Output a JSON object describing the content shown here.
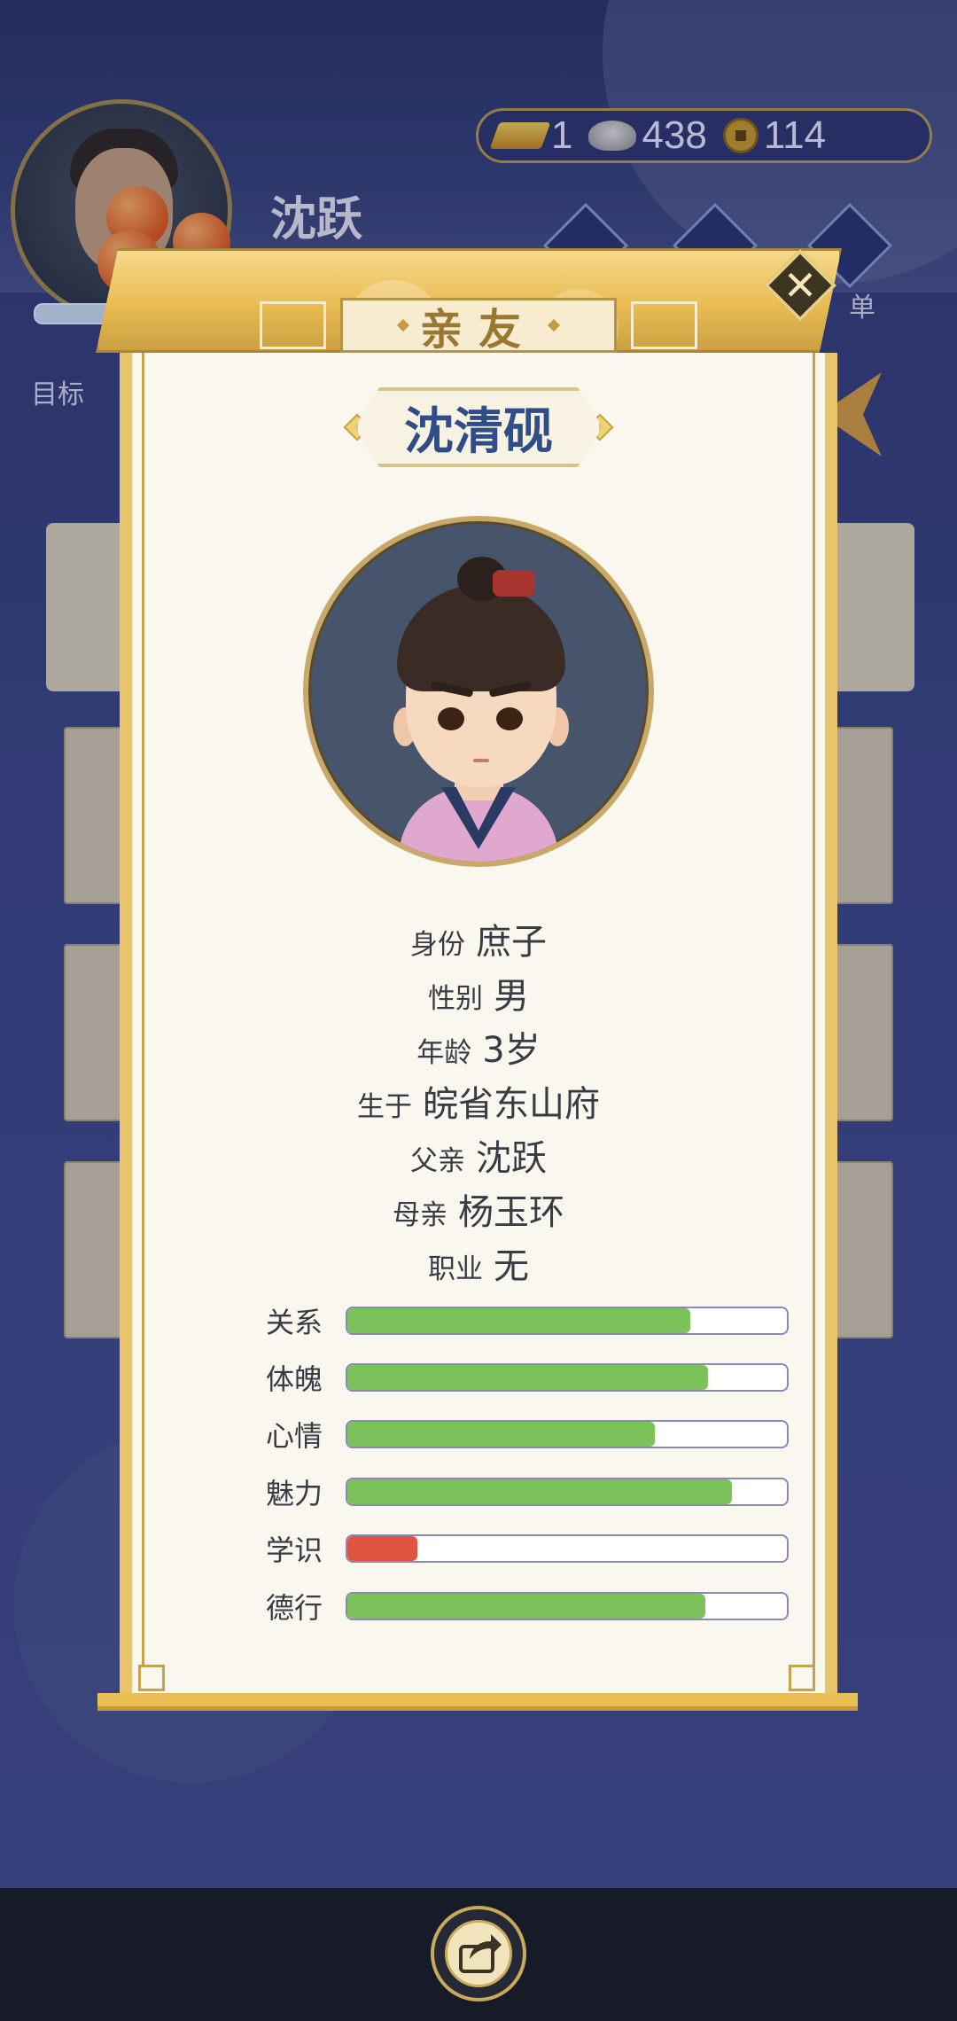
{
  "hud": {
    "player_name": "沈跃",
    "goal_label": "目标",
    "side_label": "单",
    "currency": {
      "gold": "1",
      "silver": "438",
      "coins": "114"
    }
  },
  "dialog": {
    "title": "亲友",
    "close_symbol": "✕",
    "name": "沈清砚",
    "info": [
      {
        "key": "身份",
        "value": "庶子"
      },
      {
        "key": "性别",
        "value": "男"
      },
      {
        "key": "年龄",
        "value": "3岁"
      },
      {
        "key": "生于",
        "value": "皖省东山府"
      },
      {
        "key": "父亲",
        "value": "沈跃"
      },
      {
        "key": "母亲",
        "value": "杨玉环"
      },
      {
        "key": "职业",
        "value": "无"
      }
    ],
    "stats": [
      {
        "label": "关系",
        "value": 0.78,
        "color": "#7cc25a"
      },
      {
        "label": "体魄",
        "value": 0.82,
        "color": "#7cc25a"
      },
      {
        "label": "心情",
        "value": 0.7,
        "color": "#7cc25a"
      },
      {
        "label": "魅力",
        "value": 0.875,
        "color": "#7cc25a"
      },
      {
        "label": "学识",
        "value": 0.16,
        "color": "#df5540"
      },
      {
        "label": "德行",
        "value": 0.815,
        "color": "#7cc25a"
      }
    ]
  },
  "icons": {
    "close": "close-icon",
    "share": "share-icon",
    "gold": "gold-ingot-icon",
    "silver": "silver-ingot-icon",
    "coin": "copper-coin-icon"
  }
}
